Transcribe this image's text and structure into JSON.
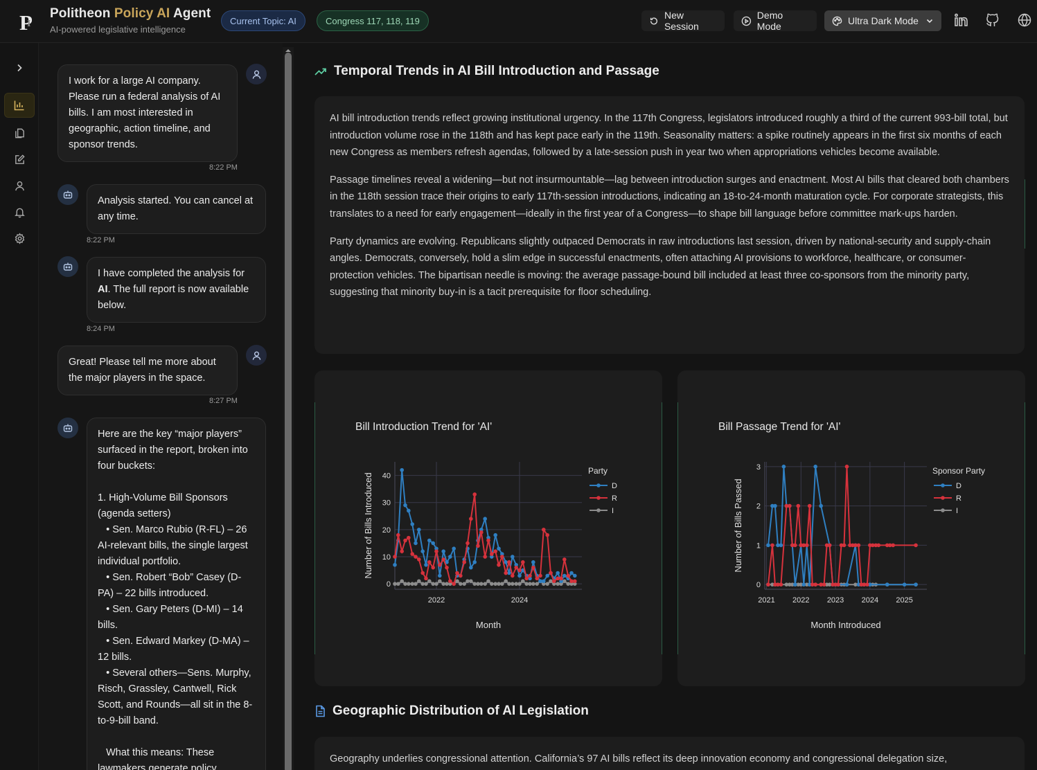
{
  "header": {
    "brand": {
      "word1": "Politheon",
      "word2": "Policy AI",
      "word3": "Agent",
      "subtitle": "AI-powered legislative intelligence"
    },
    "pills": {
      "topic": "Current Topic: AI",
      "congress": "Congress 117, 118, 119"
    },
    "buttons": {
      "new_session": "New Session",
      "demo_mode": "Demo Mode",
      "theme": "Ultra Dark Mode"
    },
    "icons": [
      "linkedin-icon",
      "github-icon",
      "globe-icon"
    ]
  },
  "rail": {
    "items": [
      "expand-icon",
      "chart-icon",
      "documents-icon",
      "edit-icon",
      "user-icon",
      "bell-icon",
      "settings-icon"
    ]
  },
  "chat": {
    "messages": [
      {
        "role": "user",
        "text": "I work for a large AI company. Please run a federal analysis of AI bills. I am most interested in geographic, action timeline, and sponsor trends.",
        "time": "8:22 PM"
      },
      {
        "role": "bot",
        "text": "Analysis started. You can cancel at any time.",
        "time": "8:22 PM"
      },
      {
        "role": "bot",
        "text_pre": "I have completed the analysis for ",
        "text_bold": "AI",
        "text_post": ". The full report is now available below.",
        "time": "8:24 PM"
      },
      {
        "role": "user",
        "text": "Great! Please tell me more about the major players in the space.",
        "time": "8:27 PM"
      },
      {
        "role": "bot",
        "lines": [
          "Here are the key “major players” surfaced in the report, broken into four buckets:",
          "",
          "1. High-Volume Bill Sponsors (agenda setters)",
          "   • Sen. Marco Rubio (R-FL) – 26 AI-relevant bills, the single largest individual portfolio.",
          "   • Sen. Robert “Bob” Casey (D-PA) – 22 bills introduced.",
          "   • Sen. Gary Peters (D-MI) – 14 bills.",
          "   • Sen. Edward Markey (D-MA) – 12 bills.",
          "   • Several others—Sens. Murphy, Risch, Grassley, Cantwell, Rick Scott, and Rounds—all sit in the 8-to-9-bill band.",
          "",
          "   What this means: These lawmakers generate policy"
        ]
      }
    ]
  },
  "main": {
    "section1": {
      "title": "Temporal Trends in AI Bill Introduction and Passage",
      "paragraphs": [
        "AI bill introduction trends reflect growing institutional urgency. In the 117th Congress, legislators introduced roughly a third of the current 993-bill total, but introduction volume rose in the 118th and has kept pace early in the 119th. Seasonality matters: a spike routinely appears in the first six months of each new Congress as members refresh agendas, followed by a late-session push in year two when appropriations vehicles become available.",
        "Passage timelines reveal a widening—but not insurmountable—lag between introduction surges and enactment. Most AI bills that cleared both chambers in the 118th session trace their origins to early 117th-session introductions, indicating an 18-to-24-month maturation cycle. For corporate strategists, this translates to a need for early engagement—ideally in the first year of a Congress—to shape bill language before committee mark-ups harden.",
        "Party dynamics are evolving. Republicans slightly outpaced Democrats in raw introductions last session, driven by national-security and supply-chain angles. Democrats, conversely, hold a slim edge in successful enactments, often attaching AI provisions to workforce, healthcare, or consumer-protection vehicles. The bipartisan needle is moving: the average passage-bound bill included at least three co-sponsors from the minority party, suggesting that minority buy-in is a tacit prerequisite for floor scheduling."
      ]
    },
    "section2": {
      "title": "Geographic Distribution of AI Legislation",
      "paragraph": "Geography underlies congressional attention. California’s 97 AI bills reflect its deep innovation economy and congressional delegation size,"
    }
  },
  "chart_data": [
    {
      "type": "line",
      "title": "Bill Introduction Trend for 'AI'",
      "xlabel": "Month",
      "ylabel": "Number of Bills Introduced",
      "legend_title": "Party",
      "legend_position": "top-right",
      "xlim": [
        2021.0,
        2025.5
      ],
      "ylim": [
        -2,
        45
      ],
      "xticks": [
        "2022",
        "2024"
      ],
      "yticks": [
        0,
        10,
        20,
        30,
        40
      ],
      "grid": true,
      "series": [
        {
          "name": "D",
          "color": "#2f7fc1",
          "x": [
            2021.0,
            2021.08,
            2021.17,
            2021.25,
            2021.33,
            2021.42,
            2021.5,
            2021.58,
            2021.67,
            2021.75,
            2021.83,
            2021.92,
            2022.0,
            2022.08,
            2022.17,
            2022.25,
            2022.33,
            2022.42,
            2022.5,
            2022.58,
            2022.67,
            2022.75,
            2022.83,
            2022.92,
            2023.0,
            2023.08,
            2023.17,
            2023.25,
            2023.33,
            2023.42,
            2023.5,
            2023.58,
            2023.67,
            2023.75,
            2023.83,
            2023.92,
            2024.0,
            2024.08,
            2024.17,
            2024.25,
            2024.33,
            2024.42,
            2024.5,
            2024.58,
            2024.67,
            2024.75,
            2024.83,
            2024.92,
            2025.0,
            2025.08,
            2025.17,
            2025.25,
            2025.33
          ],
          "y": [
            7,
            16,
            42,
            29,
            27,
            22,
            15,
            20,
            12,
            7,
            16,
            15,
            13,
            3,
            12,
            8,
            10,
            13,
            3,
            3,
            9,
            13,
            6,
            8,
            16,
            20,
            24,
            17,
            10,
            18,
            13,
            11,
            8,
            4,
            10,
            7,
            3,
            5,
            3,
            2,
            8,
            3,
            1,
            1,
            3,
            4,
            2,
            4,
            1,
            3,
            2,
            4,
            3
          ]
        },
        {
          "name": "R",
          "color": "#d6323c",
          "x": [
            2021.0,
            2021.08,
            2021.17,
            2021.25,
            2021.33,
            2021.42,
            2021.5,
            2021.58,
            2021.67,
            2021.75,
            2021.83,
            2021.92,
            2022.0,
            2022.08,
            2022.17,
            2022.25,
            2022.33,
            2022.42,
            2022.5,
            2022.58,
            2022.67,
            2022.75,
            2022.83,
            2022.92,
            2023.0,
            2023.08,
            2023.17,
            2023.25,
            2023.33,
            2023.42,
            2023.5,
            2023.58,
            2023.67,
            2023.75,
            2023.83,
            2023.92,
            2024.0,
            2024.08,
            2024.17,
            2024.25,
            2024.33,
            2024.42,
            2024.5,
            2024.58,
            2024.67,
            2024.75,
            2024.83,
            2024.92,
            2025.0,
            2025.08,
            2025.17,
            2025.25,
            2025.33
          ],
          "y": [
            10,
            18,
            12,
            16,
            17,
            11,
            10,
            9,
            4,
            2,
            8,
            6,
            12,
            7,
            9,
            6,
            1,
            0,
            4,
            3,
            8,
            15,
            24,
            33,
            14,
            19,
            10,
            16,
            11,
            12,
            7,
            10,
            4,
            8,
            3,
            6,
            5,
            8,
            2,
            3,
            6,
            2,
            3,
            20,
            18,
            4,
            1,
            2,
            2,
            9,
            3,
            1,
            1
          ]
        },
        {
          "name": "I",
          "color": "#8c8c8c",
          "x": [
            2021.0,
            2021.08,
            2021.17,
            2021.25,
            2021.33,
            2021.42,
            2021.5,
            2021.58,
            2021.67,
            2021.75,
            2021.83,
            2021.92,
            2022.0,
            2022.08,
            2022.17,
            2022.25,
            2022.33,
            2022.42,
            2022.5,
            2022.58,
            2022.67,
            2022.75,
            2022.83,
            2022.92,
            2023.0,
            2023.08,
            2023.17,
            2023.25,
            2023.33,
            2023.42,
            2023.5,
            2023.58,
            2023.67,
            2023.75,
            2023.83,
            2023.92,
            2024.0,
            2024.08,
            2024.17,
            2024.25,
            2024.33,
            2024.42,
            2024.5,
            2024.58,
            2024.67,
            2024.75,
            2024.83,
            2024.92,
            2025.0,
            2025.08,
            2025.17,
            2025.25,
            2025.33
          ],
          "y": [
            0,
            0,
            1,
            0,
            0,
            0,
            0,
            1,
            0,
            0,
            1,
            0,
            0,
            1,
            0,
            0,
            0,
            0,
            1,
            0,
            0,
            1,
            1,
            0,
            0,
            0,
            0,
            1,
            0,
            0,
            0,
            0,
            1,
            0,
            0,
            0,
            0,
            1,
            0,
            0,
            0,
            0,
            1,
            0,
            0,
            1,
            0,
            0,
            0,
            1,
            0,
            0,
            0
          ]
        }
      ]
    },
    {
      "type": "line",
      "title": "Bill Passage Trend for 'AI'",
      "xlabel": "Month Introduced",
      "ylabel": "Number of Bills Passed",
      "legend_title": "Sponsor Party",
      "legend_position": "top-right",
      "xlim": [
        2020.95,
        2025.65
      ],
      "ylim": [
        -0.12,
        3.12
      ],
      "xticks": [
        "2021",
        "2022",
        "2023",
        "2024",
        "2025"
      ],
      "yticks": [
        0,
        1,
        2,
        3
      ],
      "grid": true,
      "series": [
        {
          "name": "D",
          "color": "#2f7fc1",
          "x": [
            2021.05,
            2021.17,
            2021.25,
            2021.33,
            2021.42,
            2021.5,
            2021.58,
            2021.67,
            2021.75,
            2021.83,
            2022.0,
            2022.08,
            2022.17,
            2022.25,
            2022.42,
            2022.58,
            2022.83,
            2022.92,
            2023.0,
            2023.08,
            2023.33,
            2023.58,
            2023.67,
            2023.75,
            2023.83,
            2024.0,
            2024.5,
            2025.0,
            2025.33
          ],
          "y": [
            1,
            2,
            2,
            1,
            1,
            3,
            2,
            2,
            1,
            0,
            1,
            0,
            1,
            0,
            3,
            2,
            1,
            0,
            0,
            0,
            0,
            1,
            0,
            0,
            0,
            0,
            0,
            0,
            0
          ]
        },
        {
          "name": "R",
          "color": "#d6323c",
          "x": [
            2021.05,
            2021.17,
            2021.25,
            2021.33,
            2021.42,
            2021.58,
            2021.67,
            2021.75,
            2021.83,
            2021.92,
            2022.0,
            2022.08,
            2022.17,
            2022.25,
            2022.33,
            2022.42,
            2022.58,
            2022.67,
            2022.75,
            2022.83,
            2022.92,
            2023.0,
            2023.08,
            2023.17,
            2023.25,
            2023.33,
            2023.42,
            2023.5,
            2023.58,
            2023.67,
            2023.75,
            2023.83,
            2023.92,
            2024.0,
            2024.08,
            2024.17,
            2024.25,
            2024.5,
            2024.58,
            2024.67,
            2025.33
          ],
          "y": [
            0,
            1,
            0,
            0,
            0,
            2,
            2,
            1,
            1,
            2,
            1,
            1,
            1,
            2,
            0,
            0,
            0,
            0,
            1,
            1,
            0,
            0,
            0,
            1,
            1,
            3,
            1,
            1,
            1,
            1,
            0,
            0,
            0,
            1,
            1,
            1,
            1,
            1,
            1,
            1,
            1
          ]
        },
        {
          "name": "I",
          "color": "#8c8c8c",
          "x": [
            2021.05,
            2021.17,
            2021.25,
            2021.33,
            2021.42,
            2021.58,
            2021.67,
            2021.75,
            2021.83,
            2021.92,
            2022.0,
            2022.08,
            2022.17,
            2022.25,
            2022.33,
            2022.42,
            2022.58,
            2022.67,
            2022.75,
            2022.83,
            2022.92,
            2023.0,
            2023.08,
            2023.17,
            2023.25,
            2023.33,
            2023.58,
            2023.67,
            2023.75,
            2023.83,
            2024.0,
            2024.08,
            2024.17,
            2024.5,
            2025.33
          ],
          "y": [
            0,
            0,
            0,
            0,
            0,
            0,
            0,
            0,
            0,
            0,
            0,
            0,
            0,
            0,
            0,
            0,
            0,
            0,
            0,
            0,
            0,
            0,
            0,
            0,
            0,
            0,
            0,
            0,
            0,
            0,
            0,
            0,
            0,
            0,
            0
          ]
        }
      ]
    }
  ]
}
